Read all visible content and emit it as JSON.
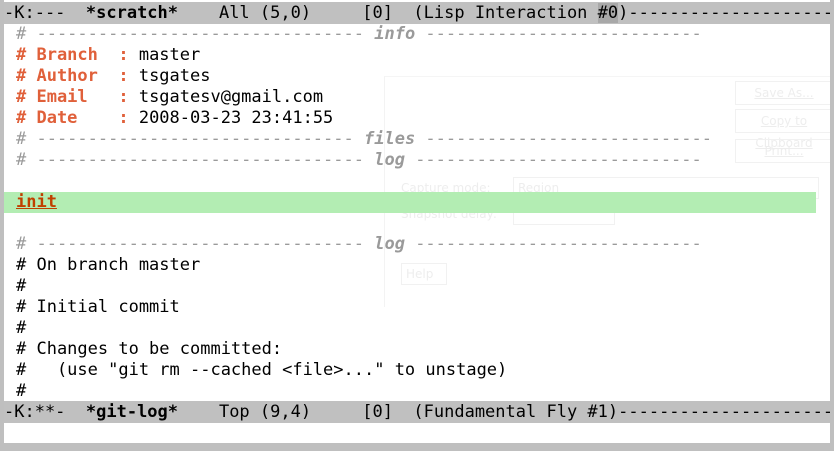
{
  "top_modeline": {
    "flags": "-K:---  ",
    "buffer_name": "*scratch*",
    "position": "    All (5,0)     [0]  (Lisp Interaction ",
    "frame": "#0",
    "tail": ")-----------------------------------"
  },
  "bottom_modeline": {
    "flags": "-K:**-  ",
    "buffer_name": "*git-log*",
    "position": "    Top (9,4)     [0]  (Fundamental Fly #1)",
    "tail": "-----------------------------------------"
  },
  "buffer": {
    "sep_info_left": "# -------------------------------- ",
    "sep_info_word": "info",
    "sep_info_right": " ---------------------------",
    "branch_key": "# Branch  :",
    "branch_value": " master",
    "author_key": "# Author  :",
    "author_value": " tsgates",
    "email_key": "# Email   :",
    "email_value": " tsgatesv@gmail.com",
    "date_key": "# Date    :",
    "date_value": " 2008-03-23 23:41:55",
    "sep_files_left": "# ------------------------------- ",
    "sep_files_word": "files",
    "sep_files_right": " ----------------------------",
    "sep_log1_left": "# -------------------------------- ",
    "sep_log1_word": "log",
    "sep_log1_right": " ----------------------------",
    "commit_message": "init",
    "sep_log2_left": "# -------------------------------- ",
    "sep_log2_word": "log",
    "sep_log2_right": " ----------------------------",
    "status_lines": [
      "# On branch master",
      "#",
      "# Initial commit",
      "#",
      "# Changes to be committed:",
      "#   (use \"git rm --cached <file>...\" to unstage)",
      "#"
    ]
  },
  "ghost_dialog": {
    "save_as": "Save As...",
    "copy_to_clipboard": "Copy to Clipboard",
    "print": "Print...",
    "capture_mode_label": "Capture mode:",
    "capture_mode_value": "Region",
    "snapshot_delay_label": "Snapshot delay:",
    "help": "Help"
  },
  "colors": {
    "modeline_bg": "#c0c0c0",
    "highlight_bg": "#b3edb3",
    "key_color": "#e0603a",
    "separator_color": "#9a9a9a",
    "commit_color": "#c04000"
  }
}
